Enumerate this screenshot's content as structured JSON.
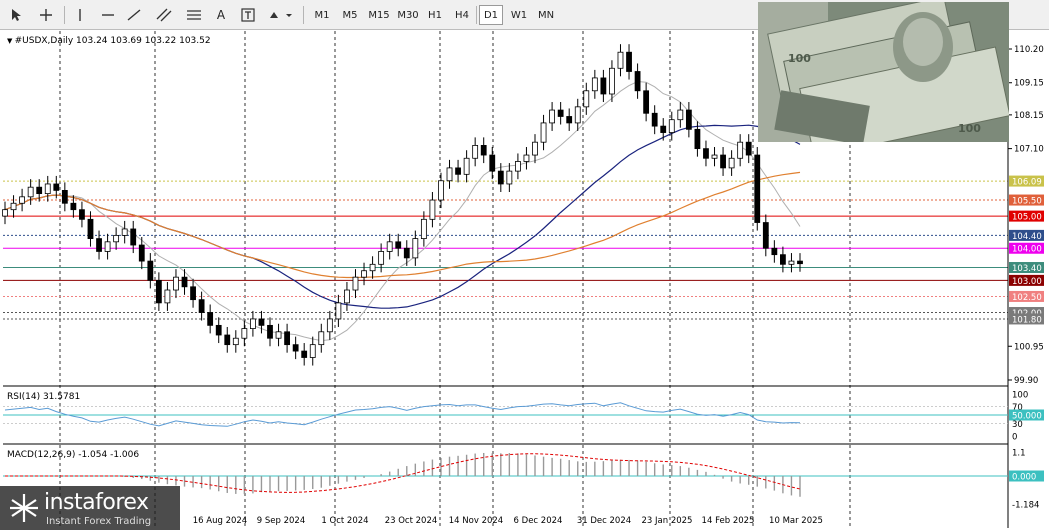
{
  "toolbar": {
    "timeframes": [
      "M1",
      "M5",
      "M15",
      "M30",
      "H1",
      "H4",
      "D1",
      "W1",
      "MN"
    ],
    "active_timeframe": "D1"
  },
  "chart_data": [
    {
      "type": "candlestick",
      "symbol": "#USDX",
      "timeframe": "Daily",
      "ohlc_header": "103.24 103.69 103.22 103.52",
      "price_ticks": [
        "110.20",
        "109.15",
        "108.15",
        "107.10",
        "100.95",
        "99.90"
      ],
      "x_tick_labels": [
        "16 Aug 2024",
        "9 Sep 2024",
        "1 Oct 2024",
        "23 Oct 2024",
        "14 Nov 2024",
        "6 Dec 2024",
        "31 Dec 2024",
        "23 Jan 2025",
        "14 Feb 2025",
        "10 Mar 2025"
      ],
      "levels": [
        {
          "value": 106.09,
          "label": "106.09",
          "color": "#c9c24a",
          "style": "dotted"
        },
        {
          "value": 105.5,
          "label": "105.50",
          "color": "#e0603a",
          "style": "dotted"
        },
        {
          "value": 105.0,
          "label": "105.00",
          "color": "#e00000",
          "style": "solid"
        },
        {
          "value": 104.4,
          "label": "104.40",
          "color": "#2e4e8c",
          "style": "dotted"
        },
        {
          "value": 104.0,
          "label": "104.00",
          "color": "#ee00ee",
          "style": "solid"
        },
        {
          "value": 103.4,
          "label": "103.40",
          "color": "#3c8c7c",
          "style": "solid"
        },
        {
          "value": 103.0,
          "label": "103.00",
          "color": "#8b0000",
          "style": "solid"
        },
        {
          "value": 102.5,
          "label": "102.50",
          "color": "#f08080",
          "style": "dotted"
        },
        {
          "value": 102.0,
          "label": "102.00",
          "color": "#555555",
          "style": "dotted"
        },
        {
          "value": 101.8,
          "label": "101.80",
          "color": "#555555",
          "style": "dotted"
        }
      ],
      "close": [
        105.2,
        105.4,
        105.6,
        105.9,
        105.7,
        106.0,
        105.8,
        105.4,
        105.2,
        104.9,
        104.3,
        103.9,
        104.2,
        104.4,
        104.6,
        104.1,
        103.6,
        103.0,
        102.3,
        102.7,
        103.1,
        102.8,
        102.4,
        102.0,
        101.6,
        101.3,
        101.0,
        101.2,
        101.5,
        101.8,
        101.6,
        101.2,
        101.4,
        101.0,
        100.8,
        100.6,
        101.0,
        101.4,
        101.8,
        102.3,
        102.7,
        103.1,
        103.3,
        103.5,
        103.9,
        104.2,
        104.0,
        103.7,
        104.3,
        104.9,
        105.5,
        106.1,
        106.5,
        106.3,
        106.8,
        107.2,
        106.9,
        106.4,
        106.0,
        106.4,
        106.7,
        106.9,
        107.3,
        107.9,
        108.3,
        108.1,
        107.9,
        108.4,
        108.9,
        109.3,
        108.8,
        109.6,
        110.1,
        109.5,
        108.9,
        108.2,
        107.8,
        107.6,
        108.0,
        108.3,
        107.7,
        107.1,
        106.8,
        106.9,
        106.5,
        106.8,
        107.3,
        106.9,
        104.8,
        104.0,
        103.8,
        103.5,
        103.6,
        103.52
      ],
      "indicators": {
        "ma_short_color": "#b0b0b0",
        "ma_mid_color": "#1a237e",
        "ma_long_color": "#e08030"
      }
    },
    {
      "type": "line",
      "name": "RSI(14)",
      "value_label": "31.5781",
      "y_ticks": [
        "100",
        "70",
        "50.000",
        "30",
        "0"
      ],
      "ylim": [
        0,
        100
      ],
      "values": [
        62,
        64,
        66,
        68,
        63,
        66,
        58,
        52,
        47,
        43,
        35,
        33,
        38,
        42,
        45,
        40,
        34,
        28,
        24,
        30,
        36,
        33,
        30,
        27,
        25,
        24,
        23,
        28,
        34,
        38,
        35,
        31,
        34,
        31,
        29,
        27,
        33,
        40,
        46,
        52,
        57,
        62,
        63,
        65,
        68,
        70,
        66,
        61,
        66,
        70,
        72,
        74,
        75,
        72,
        74,
        74,
        70,
        66,
        63,
        67,
        70,
        71,
        73,
        76,
        77,
        74,
        72,
        75,
        77,
        78,
        72,
        76,
        79,
        72,
        66,
        60,
        58,
        57,
        61,
        64,
        58,
        52,
        49,
        51,
        47,
        51,
        56,
        51,
        38,
        34,
        33,
        31,
        32,
        31.6
      ],
      "color": "#5a9bd5"
    },
    {
      "type": "bar",
      "name": "MACD(12,26,9)",
      "value_label": "-1.054 -1.006",
      "y_ticks": [
        "1.1",
        "0.000",
        "-1.184"
      ],
      "ylim": [
        -1.184,
        1.1
      ],
      "signal_color": "#e00000"
    }
  ],
  "watermark": {
    "name": "instaforex",
    "tagline": "Instant Forex Trading"
  }
}
